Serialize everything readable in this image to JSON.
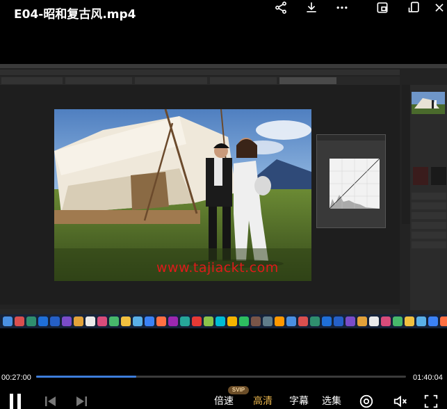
{
  "header": {
    "title": "E04-昭和复古风.mp4",
    "icons": [
      "share-icon",
      "download-icon",
      "more-icon",
      "picture-in-picture-icon",
      "screen-rotate-icon",
      "close-icon"
    ]
  },
  "video": {
    "watermark": "www.tajiackt.com",
    "taskbar_icons": [
      "finder",
      "launchpad",
      "lightroom",
      "photoshop",
      "photoshop",
      "app",
      "notes",
      "photos",
      "calendar",
      "app",
      "app",
      "app",
      "folder",
      "app",
      "app",
      "app",
      "music",
      "app",
      "app",
      "chrome",
      "wechat",
      "app",
      "app",
      "app",
      "app",
      "vlc",
      "app",
      "app",
      "app",
      "app",
      "app",
      "app",
      "app",
      "app",
      "app",
      "app",
      "app",
      "trash"
    ]
  },
  "player": {
    "current_time": "00:27:00",
    "total_time": "01:40:04",
    "progress_fraction": 0.27,
    "buffered_fraction": 0.27,
    "speed_label": "倍速",
    "speed_badge": "SVIP",
    "quality_label": "高清",
    "subtitle_label": "字幕",
    "episodes_label": "选集"
  },
  "colors": {
    "accent": "#3d7ddb",
    "quality": "#e8b44c",
    "watermark": "#e01a1a"
  }
}
